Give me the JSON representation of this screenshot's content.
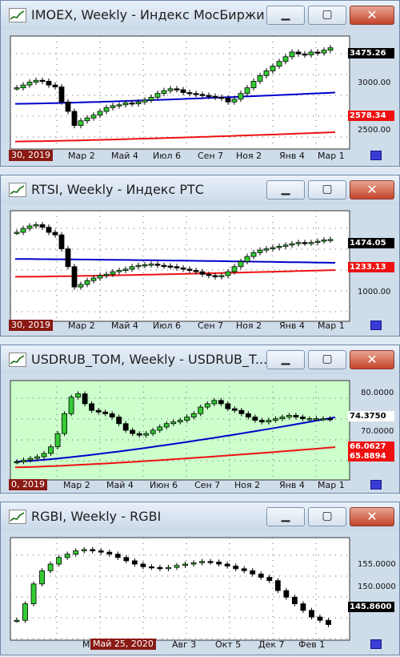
{
  "windows": [
    {
      "title": "IMOEX, Weekly - Индекс МосБиржи",
      "scale_labels": [
        "3000.00",
        "2500.00"
      ],
      "price_tags": [
        {
          "text": "3475.26",
          "kind": "last"
        },
        {
          "text": "2578.34",
          "kind": "red"
        }
      ],
      "start_date": "30, 2019",
      "dates": [
        "Мар 2",
        "Май 4",
        "Июл 6",
        "Сен 7",
        "Ноя 2",
        "Янв 4",
        "Мар 1"
      ],
      "bg": "#ffffff"
    },
    {
      "title": "RTSI, Weekly - Индекс РТС",
      "scale_labels": [
        "1000.00"
      ],
      "price_tags": [
        {
          "text": "1474.05",
          "kind": "last"
        },
        {
          "text": "1233.13",
          "kind": "red"
        }
      ],
      "start_date": "30, 2019",
      "dates": [
        "Мар 2",
        "Май 4",
        "Июл 6",
        "Сен 7",
        "Ноя 2",
        "Янв 4",
        "Мар 1"
      ],
      "bg": "#ffffff"
    },
    {
      "title": "USDRUB_TOM, Weekly - USDRUB_T...",
      "scale_labels": [
        "80.0000",
        "70.0000"
      ],
      "price_tags": [
        {
          "text": "74.3750",
          "kind": "last"
        },
        {
          "text": "66.0627",
          "kind": "red"
        },
        {
          "text": "65.8894",
          "kind": "red"
        }
      ],
      "start_date": "0, 2019",
      "dates": [
        "Мар 2",
        "Май 4",
        "Июн 6",
        "Сен 7",
        "Ноя 2",
        "Янв 4",
        "Мар 1"
      ],
      "bg": "#ccffcc"
    },
    {
      "title": "RGBI, Weekly - RGBI",
      "scale_labels": [
        "155.0000",
        "150.0000"
      ],
      "price_tags": [
        {
          "text": "145.8600",
          "kind": "last"
        }
      ],
      "start_date": "Май 25, 2020",
      "dates": [
        "М",
        "Авг 3",
        "Окт 5",
        "Дек 7",
        "Фев 1"
      ],
      "bg": "#ffffff"
    }
  ],
  "chart_data": [
    {
      "type": "candlestick",
      "title": "IMOEX, Weekly - Индекс МосБиржи",
      "ylim": [
        2400,
        3600
      ],
      "close": [
        3050,
        3080,
        3110,
        3130,
        3120,
        3080,
        3060,
        2900,
        2800,
        2650,
        2700,
        2730,
        2760,
        2800,
        2840,
        2860,
        2870,
        2890,
        2880,
        2900,
        2920,
        2950,
        2990,
        3020,
        3040,
        3030,
        3000,
        2990,
        2980,
        2970,
        2960,
        2950,
        2940,
        2900,
        2930,
        2990,
        3050,
        3120,
        3180,
        3230,
        3280,
        3330,
        3380,
        3430,
        3410,
        3400,
        3430,
        3420,
        3450,
        3475.26
      ],
      "overlays": [
        {
          "name": "",
          "color": "#0000cc",
          "start": 2880,
          "end": 3000
        },
        {
          "name": "",
          "color": "#ee1111",
          "start": 2480,
          "end": 2578.34
        }
      ],
      "grid": true
    },
    {
      "type": "candlestick",
      "title": "RTSI, Weekly - Индекс РТС",
      "ylim": [
        830,
        1700
      ],
      "close": [
        1530,
        1560,
        1580,
        1590,
        1570,
        1530,
        1510,
        1400,
        1260,
        1100,
        1120,
        1150,
        1170,
        1190,
        1200,
        1220,
        1230,
        1240,
        1260,
        1270,
        1275,
        1280,
        1270,
        1265,
        1260,
        1250,
        1240,
        1230,
        1220,
        1200,
        1190,
        1180,
        1190,
        1220,
        1260,
        1300,
        1340,
        1370,
        1390,
        1400,
        1410,
        1420,
        1430,
        1440,
        1450,
        1445,
        1450,
        1460,
        1470,
        1474.05
      ],
      "overlays": [
        {
          "name": "",
          "color": "#0000cc",
          "start": 1320,
          "end": 1290
        },
        {
          "name": "",
          "color": "#ee1111",
          "start": 1180,
          "end": 1233.13
        }
      ],
      "grid": true
    },
    {
      "type": "candlestick",
      "title": "USDRUB_TOM, Weekly - USDRUB_TOM",
      "ylim": [
        56,
        86
      ],
      "close": [
        61.5,
        62,
        62.5,
        63,
        64,
        66,
        70,
        76,
        81,
        82,
        79,
        77,
        76.5,
        76,
        75,
        73,
        71,
        70,
        69.5,
        70,
        71,
        72,
        73,
        73.5,
        74,
        75,
        76,
        78,
        79,
        80,
        79,
        77.5,
        77,
        76,
        75,
        74,
        73.5,
        74,
        74.5,
        75,
        75.5,
        75,
        74.5,
        74.5,
        74.5,
        74.5,
        74.375
      ],
      "overlays": [
        {
          "name": "",
          "color": "#0000cc",
          "start": 61.5,
          "end": 74.9
        },
        {
          "name": "",
          "color": "#ee1111",
          "start": 59.8,
          "end": 65.8894
        }
      ],
      "grid": true
    },
    {
      "type": "candlestick",
      "title": "RGBI, Weekly - RGBI",
      "ylim": [
        143.5,
        159
      ],
      "close": [
        146.5,
        149,
        152,
        154,
        155,
        156,
        156.5,
        157,
        157.2,
        157,
        156.8,
        156.5,
        156,
        155.5,
        155,
        154.6,
        154.5,
        154.3,
        154.5,
        154.8,
        155,
        155.2,
        155.4,
        155.3,
        155,
        154.7,
        154.3,
        154,
        153.5,
        153,
        152.5,
        151,
        150,
        149,
        148,
        147,
        146.5,
        145.86
      ],
      "overlays": [],
      "grid": true
    }
  ]
}
